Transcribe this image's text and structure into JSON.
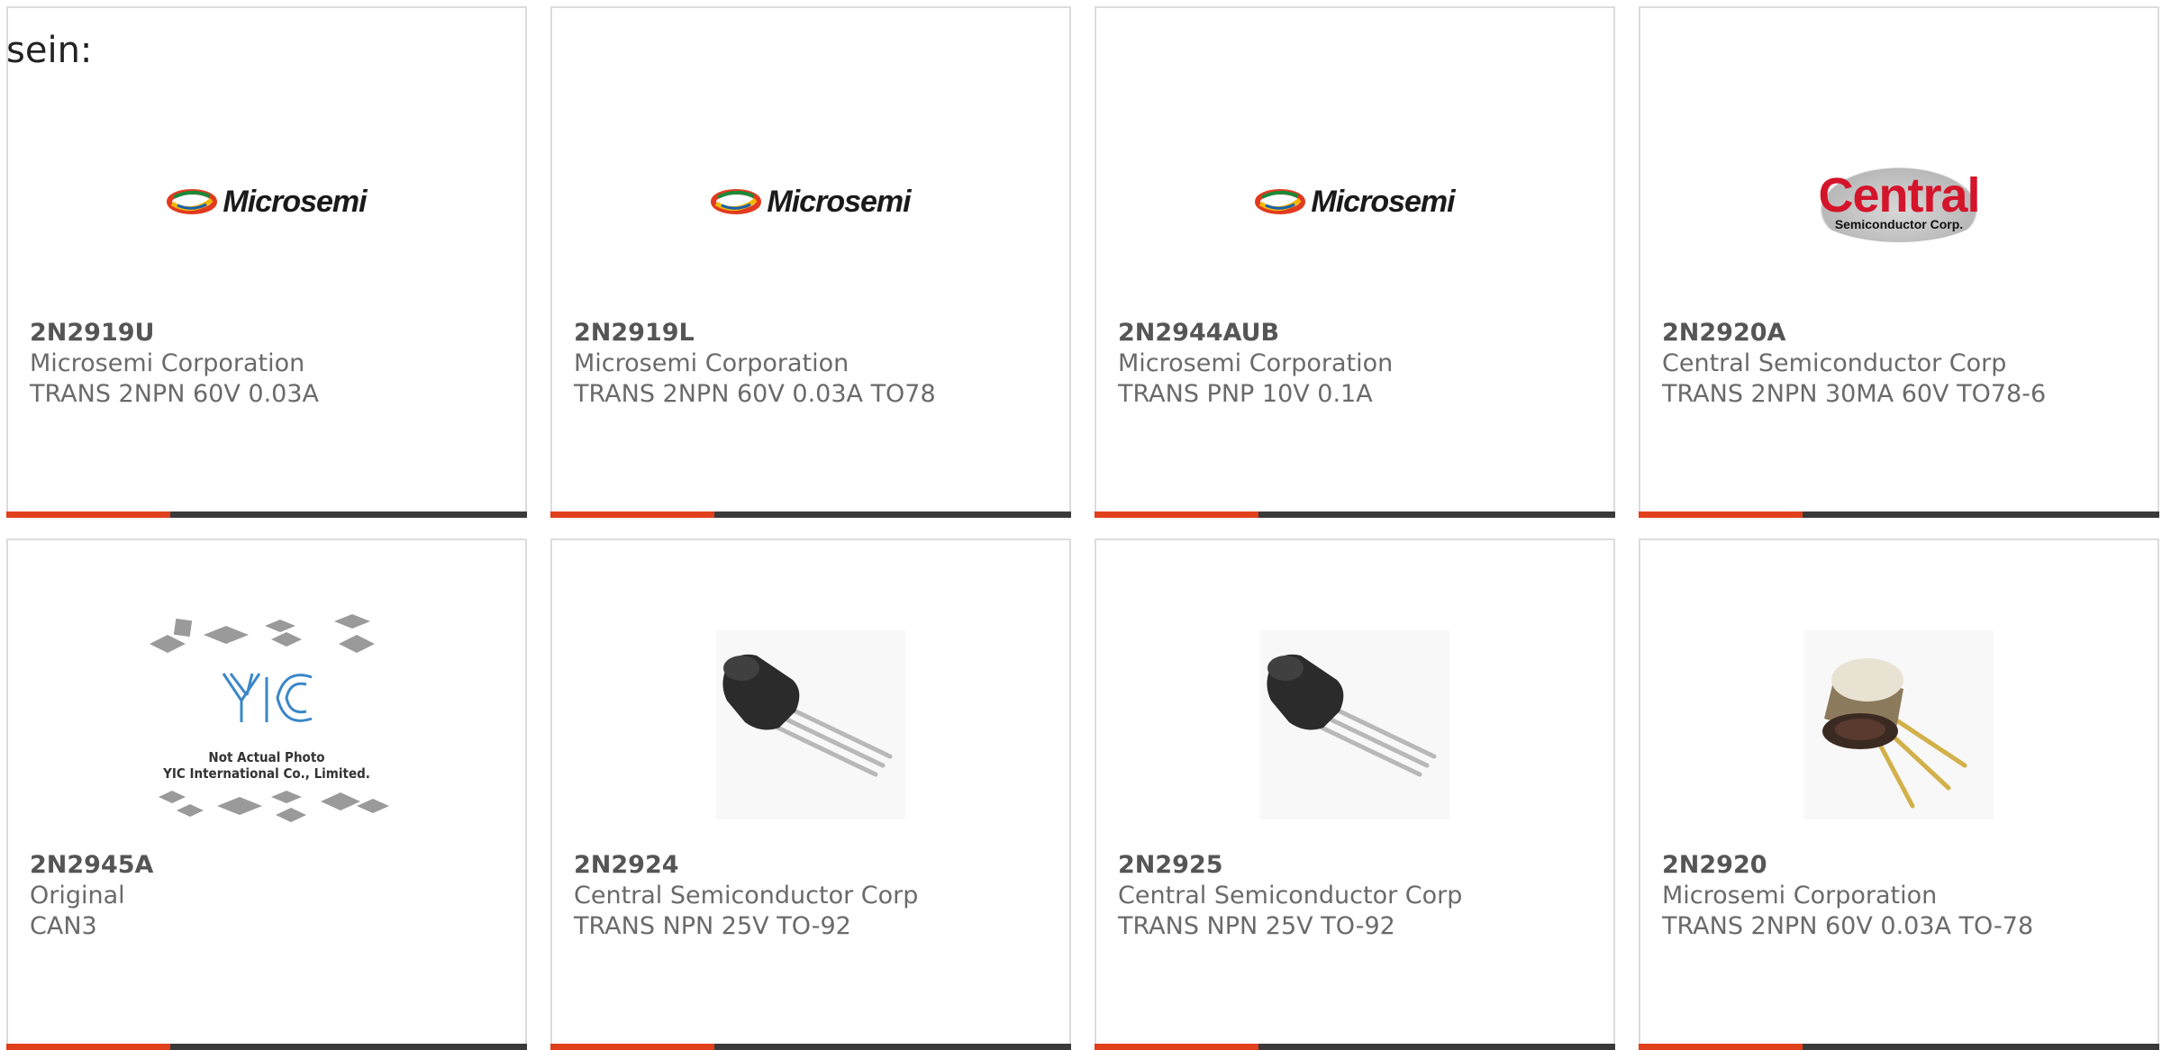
{
  "lead_text": "sein:",
  "accent_color": "#e0401c",
  "bar_color": "#3a3a3a",
  "products": [
    {
      "part": "2N2919U",
      "manufacturer": "Microsemi Corporation",
      "description": "TRANS 2NPN 60V 0.03A",
      "image": "microsemi-logo",
      "logo_text": "Microsemi"
    },
    {
      "part": "2N2919L",
      "manufacturer": "Microsemi Corporation",
      "description": "TRANS 2NPN 60V 0.03A TO78",
      "image": "microsemi-logo",
      "logo_text": "Microsemi"
    },
    {
      "part": "2N2944AUB",
      "manufacturer": "Microsemi Corporation",
      "description": "TRANS PNP 10V 0.1A",
      "image": "microsemi-logo",
      "logo_text": "Microsemi"
    },
    {
      "part": "2N2920A",
      "manufacturer": "Central Semiconductor Corp",
      "description": "TRANS 2NPN 30MA 60V TO78-6",
      "image": "central-semiconductor-logo",
      "logo_text": "Central",
      "logo_subtext": "Semiconductor Corp."
    },
    {
      "part": "2N2945A",
      "manufacturer": "Original",
      "description": "CAN3",
      "image": "yic-placeholder",
      "image_caption_1": "Not Actual Photo",
      "image_caption_2": "YIC International Co., Limited.",
      "logo_text": "YIC"
    },
    {
      "part": "2N2924",
      "manufacturer": "Central Semiconductor Corp",
      "description": "TRANS NPN 25V TO-92",
      "image": "to92-transistor-photo"
    },
    {
      "part": "2N2925",
      "manufacturer": "Central Semiconductor Corp",
      "description": "TRANS NPN 25V TO-92",
      "image": "to92-transistor-photo"
    },
    {
      "part": "2N2920",
      "manufacturer": "Microsemi Corporation",
      "description": "TRANS 2NPN 60V 0.03A TO-78",
      "image": "to78-metal-can-photo"
    }
  ]
}
